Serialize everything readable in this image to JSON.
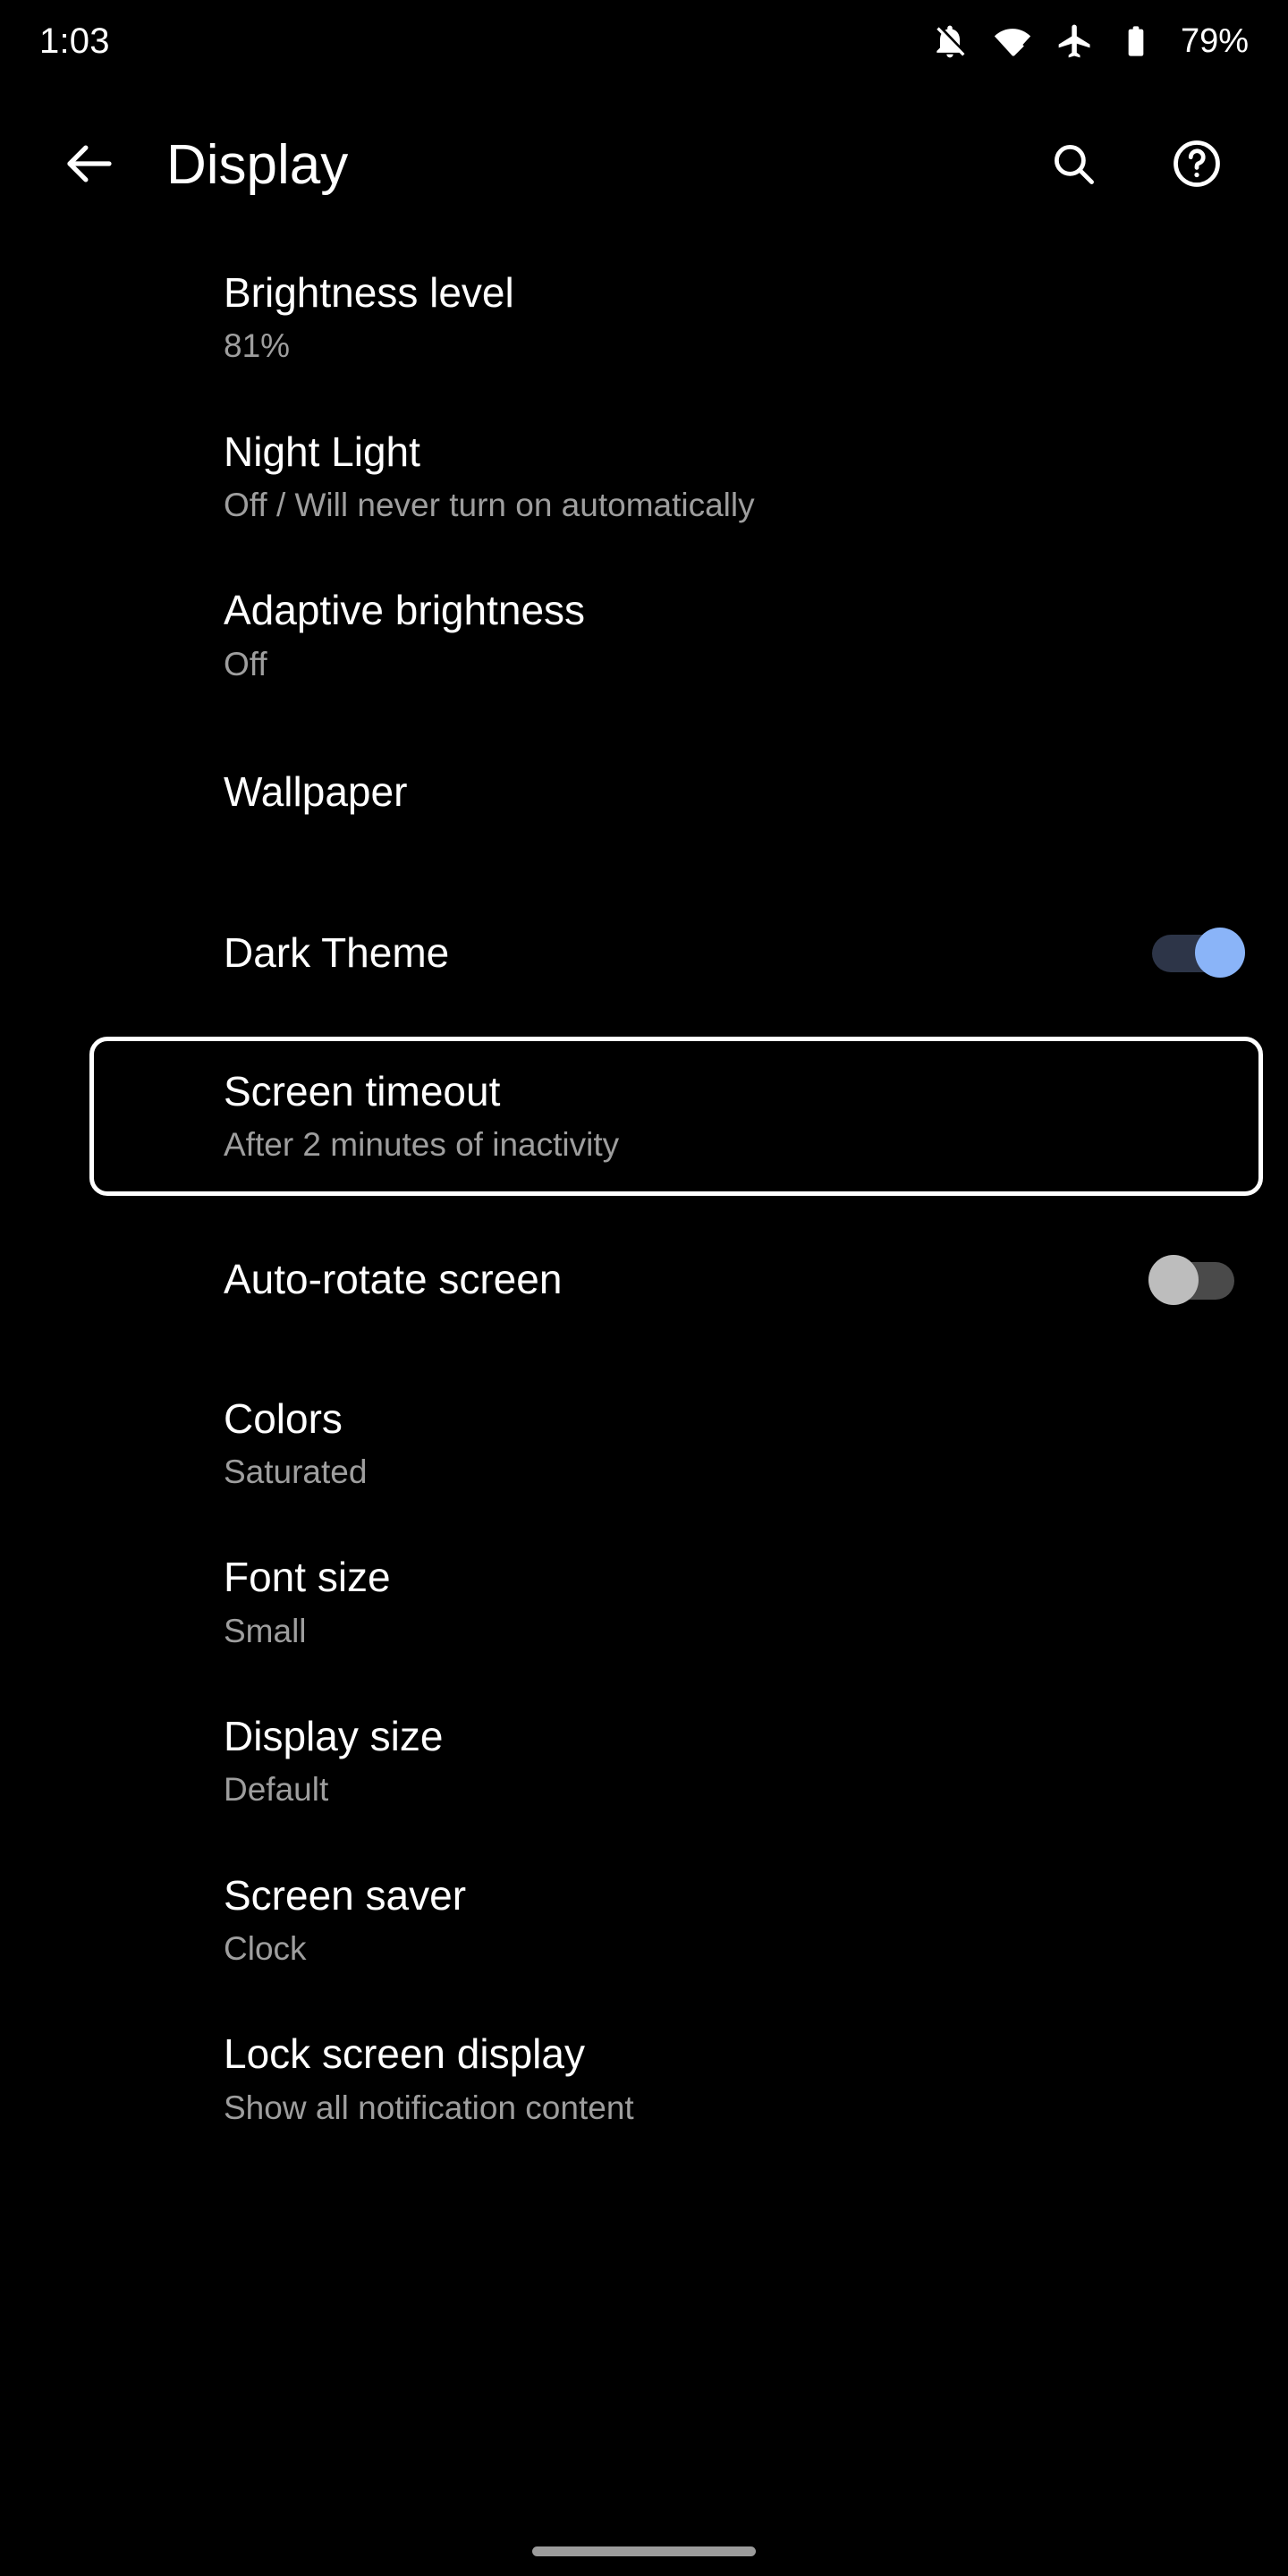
{
  "status_bar": {
    "clock": "1:03",
    "battery_percent": "79%",
    "icons": [
      "notifications-off-icon",
      "wifi-icon",
      "airplane-mode-icon",
      "battery-icon"
    ]
  },
  "app_bar": {
    "back_label": "back-arrow",
    "title": "Display",
    "search_label": "Search",
    "help_label": "Help"
  },
  "colors": {
    "background": "#000000",
    "title_text": "#ffffff",
    "summary_text": "#9e9e9e",
    "switch_on_thumb": "#8ab4f8",
    "switch_on_track": "#2d3548",
    "switch_off_thumb": "#bdbdbd",
    "switch_off_track": "#4a4a4a",
    "focus_border": "#ffffff"
  },
  "settings": [
    {
      "title": "Brightness level",
      "summary": "81%",
      "control": "none"
    },
    {
      "title": "Night Light",
      "summary": "Off / Will never turn on automatically",
      "control": "none"
    },
    {
      "title": "Adaptive brightness",
      "summary": "Off",
      "control": "none"
    },
    {
      "title": "Wallpaper",
      "summary": "",
      "control": "none"
    },
    {
      "title": "Dark Theme",
      "summary": "",
      "control": "switch",
      "switch_state": "on"
    },
    {
      "title": "Screen timeout",
      "summary": "After 2 minutes of inactivity",
      "control": "none",
      "focused": true
    },
    {
      "title": "Auto-rotate screen",
      "summary": "",
      "control": "switch",
      "switch_state": "off"
    },
    {
      "title": "Colors",
      "summary": "Saturated",
      "control": "none"
    },
    {
      "title": "Font size",
      "summary": "Small",
      "control": "none"
    },
    {
      "title": "Display size",
      "summary": "Default",
      "control": "none"
    },
    {
      "title": "Screen saver",
      "summary": "Clock",
      "control": "none"
    },
    {
      "title": "Lock screen display",
      "summary": "Show all notification content",
      "control": "none"
    }
  ],
  "nav": {
    "home_indicator": "home-gesture-pill"
  }
}
